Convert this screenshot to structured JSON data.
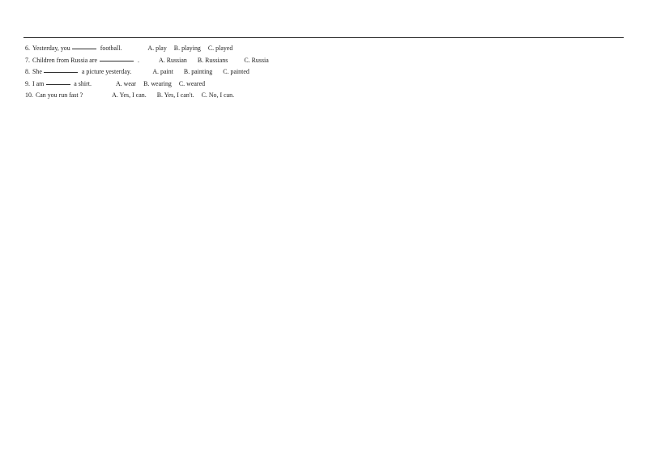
{
  "document": {
    "title": "English Grammar Multiple Choice Worksheet",
    "text_color": "#1c1c1c",
    "rule_color": "#2e2e2e",
    "background_color": "#ffffff"
  },
  "divider": {
    "name": "top-horizontal-rule"
  },
  "questions": [
    {
      "number": "6.",
      "stem_before_blank": "Yesterday, you",
      "blank": "blank-short",
      "stem_after_blank": "football.",
      "gap": 32,
      "options": [
        {
          "label": "A. play"
        },
        {
          "label": "B. playing"
        },
        {
          "label": "C. played"
        }
      ]
    },
    {
      "number": "7.",
      "stem_before_blank": "Children from Russia are",
      "blank": "blank-long",
      "stem_after_blank": ".",
      "gap": 24,
      "options": [
        {
          "label": "A. Russian"
        },
        {
          "label": "B. Russians"
        },
        {
          "label": "C. Russia"
        }
      ]
    },
    {
      "number": "8.",
      "stem_before_blank": "She",
      "blank": "blank-long",
      "stem_after_blank": "a picture yesterday.",
      "gap": 26,
      "options": [
        {
          "label": "A. paint"
        },
        {
          "label": "B. painting"
        },
        {
          "label": "C. painted"
        }
      ]
    },
    {
      "number": "9.",
      "stem_before_blank": "I am",
      "blank": "blank-short",
      "stem_after_blank": "a shirt.",
      "gap": 30,
      "options": [
        {
          "label": "A. wear"
        },
        {
          "label": "B. wearing"
        },
        {
          "label": "C. weared"
        }
      ]
    },
    {
      "number": "10.",
      "stem_before_blank": "Can you run fast ?",
      "blank": "",
      "stem_after_blank": "",
      "gap": 36,
      "options": [
        {
          "label": "A. Yes, I can."
        },
        {
          "label": "B. Yes, I can't."
        },
        {
          "label": "C. No, I can."
        }
      ]
    }
  ]
}
